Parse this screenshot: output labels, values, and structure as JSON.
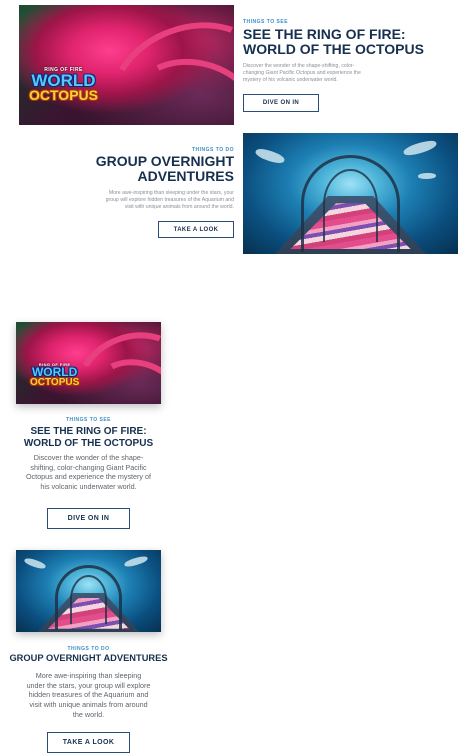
{
  "cards": [
    {
      "eyebrow": "THINGS TO SEE",
      "title_line1": "SEE THE RING OF FIRE:",
      "title_line2": "WORLD OF THE OCTOPUS",
      "description": "Discover the wonder of the shape-shifting, color-changing Giant Pacific Octopus and experience the mystery of his volcanic underwater world.",
      "button": "DIVE ON IN",
      "logo": {
        "line1": "RING OF FIRE",
        "line2": "WORLD",
        "line3": "OCTOPUS"
      }
    },
    {
      "eyebrow": "THINGS TO DO",
      "title_line1": "GROUP OVERNIGHT",
      "title_line2": "ADVENTURES",
      "title_single": "GROUP OVERNIGHT ADVENTURES",
      "description": "More awe-inspiring than sleeping under the stars, your group will explore hidden treasures of the Aquarium and visit with unique animals from around the world.",
      "button": "TAKE A LOOK"
    }
  ],
  "colors": {
    "accent": "#3a8fc6",
    "heading": "#17304f",
    "body_text": "#8b8f96",
    "button_border": "#2a4d7a"
  }
}
